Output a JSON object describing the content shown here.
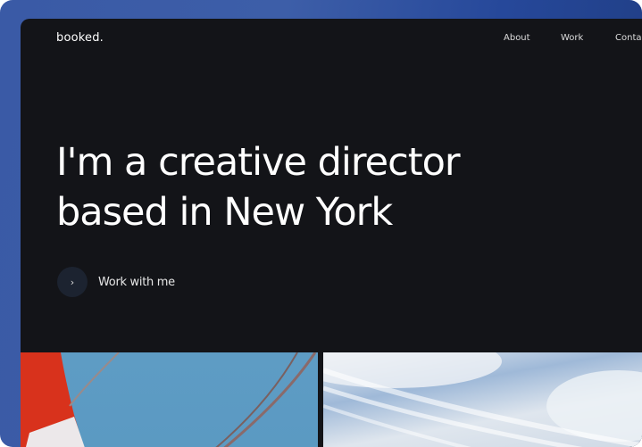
{
  "header": {
    "logo": "booked.",
    "nav": [
      "About",
      "Work",
      "Contact"
    ]
  },
  "hero": {
    "title_line1": "I'm a creative director",
    "title_line2": "based in New York"
  },
  "cta": {
    "icon": "chevron-right-icon",
    "glyph": "›",
    "label": "Work with me"
  },
  "colors": {
    "background": "#3a5aa6",
    "panel": "#131418",
    "cta_circle": "#1c2330"
  }
}
